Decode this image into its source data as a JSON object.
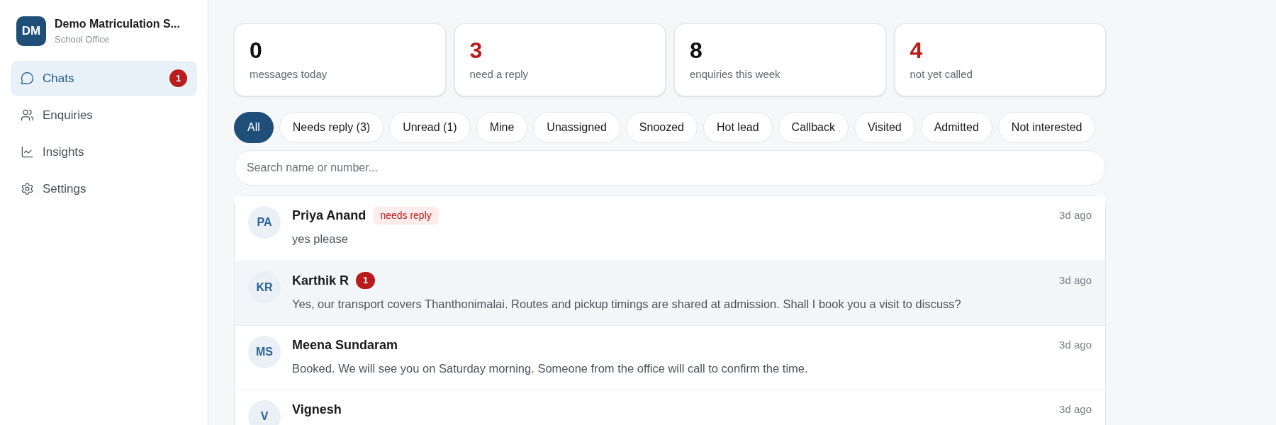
{
  "sidebar": {
    "org": {
      "initials": "DM",
      "name": "Demo Matriculation S...",
      "subtitle": "School Office"
    },
    "items": [
      {
        "label": "Chats",
        "selected": true,
        "count": "1"
      },
      {
        "label": "Enquiries",
        "selected": false
      },
      {
        "label": "Insights",
        "selected": false
      },
      {
        "label": "Settings",
        "selected": false
      }
    ]
  },
  "stats": [
    {
      "value": "0",
      "label": "messages today",
      "alert": false
    },
    {
      "value": "3",
      "label": "need a reply",
      "alert": true
    },
    {
      "value": "8",
      "label": "enquiries this week",
      "alert": false
    },
    {
      "value": "4",
      "label": "not yet called",
      "alert": true
    }
  ],
  "filters": [
    {
      "label": "All",
      "selected": true
    },
    {
      "label": "Needs reply (3)",
      "selected": false
    },
    {
      "label": "Unread (1)",
      "selected": false
    },
    {
      "label": "Mine",
      "selected": false
    },
    {
      "label": "Unassigned",
      "selected": false
    },
    {
      "label": "Snoozed",
      "selected": false
    },
    {
      "label": "Hot lead",
      "selected": false
    },
    {
      "label": "Callback",
      "selected": false
    },
    {
      "label": "Visited",
      "selected": false
    },
    {
      "label": "Admitted",
      "selected": false
    },
    {
      "label": "Not interested",
      "selected": false
    }
  ],
  "search": {
    "placeholder": "Search name or number..."
  },
  "chats": [
    {
      "initials": "PA",
      "name": "Priya Anand",
      "tag": "needs reply",
      "message": "yes please",
      "time": "3d ago",
      "unread": false
    },
    {
      "initials": "KR",
      "name": "Karthik R",
      "count": "1",
      "message": "Yes, our transport covers Thanthonimalai. Routes and pickup timings are shared at admission. Shall I book you a visit to discuss?",
      "time": "3d ago",
      "unread": true
    },
    {
      "initials": "MS",
      "name": "Meena Sundaram",
      "message": "Booked. We will see you on Saturday morning. Someone from the office will call to confirm the time.",
      "time": "3d ago",
      "unread": false
    },
    {
      "initials": "V",
      "name": "Vignesh",
      "time": "3d ago",
      "unread": false
    }
  ]
}
